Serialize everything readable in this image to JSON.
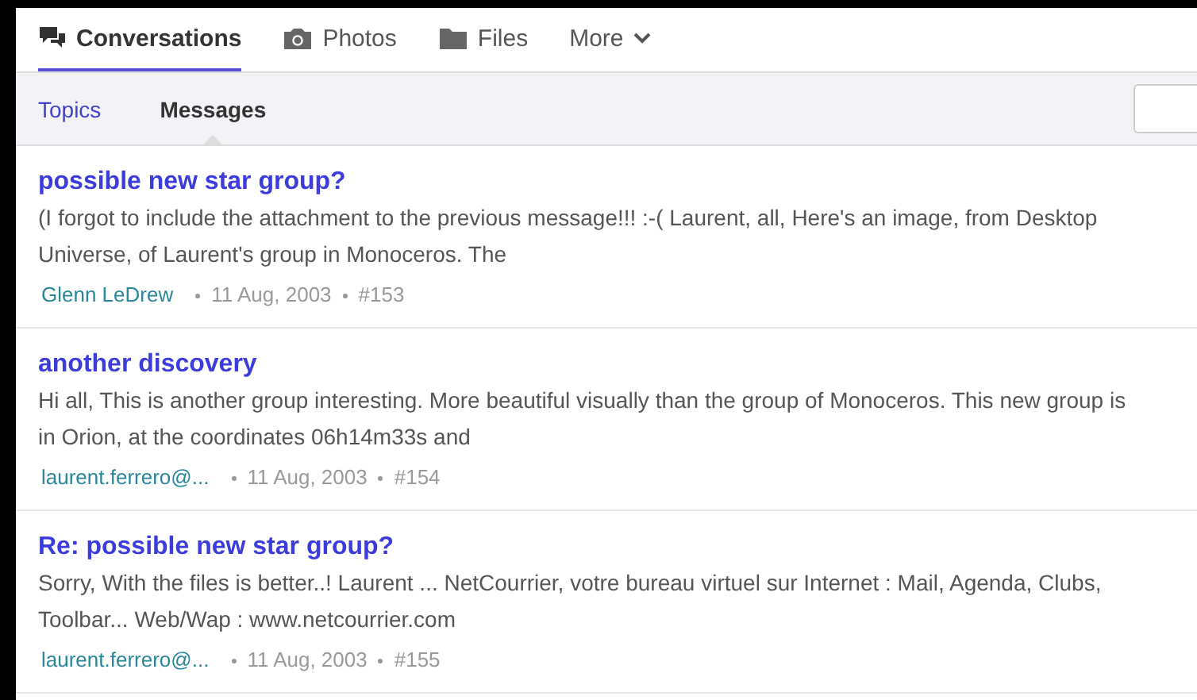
{
  "nav_tabs": [
    {
      "label": "Conversations",
      "kind": "link",
      "selected": true
    },
    {
      "label": "Photos",
      "kind": "link",
      "selected": false
    },
    {
      "label": "Files",
      "kind": "link",
      "selected": false
    },
    {
      "label": "More",
      "kind": "menu",
      "selected": false
    }
  ],
  "sub_tabs": [
    {
      "label": "Topics",
      "selected": false
    },
    {
      "label": "Messages",
      "selected": true
    }
  ],
  "messages": [
    {
      "title": "possible new star group?",
      "snippet": "(I forgot to include the attachment to the previous message!!! :-( Laurent, all, Here's an image, from Desktop Universe, of Laurent's group in Monoceros. The",
      "author": "Glenn LeDrew",
      "date": "11 Aug, 2003",
      "number": "#153"
    },
    {
      "title": "another discovery",
      "snippet": "Hi all, This is another group interesting. More beautiful visually than the group of Monoceros. This new group is in Orion, at the coordinates 06h14m33s and",
      "author": "laurent.ferrero@...",
      "date": "11 Aug, 2003",
      "number": "#154"
    },
    {
      "title": "Re: possible new star group?",
      "snippet": "Sorry, With the files is better..! Laurent ... NetCourrier, votre bureau virtuel sur Internet : Mail, Agenda, Clubs, Toolbar... Web/Wap : www.netcourrier.com",
      "author": "laurent.ferrero@...",
      "date": "11 Aug, 2003",
      "number": "#155"
    }
  ]
}
